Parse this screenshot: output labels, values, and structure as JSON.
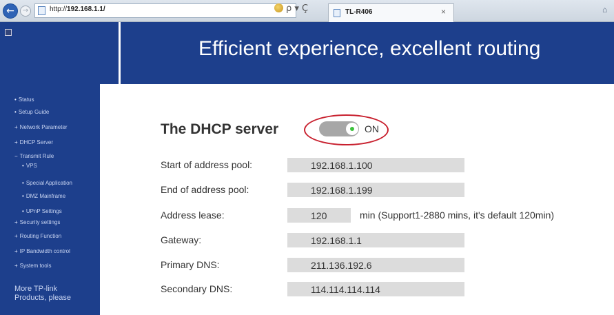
{
  "browser": {
    "url_prefix": "http://",
    "url_host": "192.168.1.1/",
    "tab_title": "TL-R406",
    "tab_close": "×",
    "back_glyph": "←",
    "forward_glyph": "→",
    "search_glyph": "ρ ▾ Ç"
  },
  "header": {
    "slogan": "Efficient experience, excellent routing"
  },
  "sidebar": {
    "items": [
      {
        "label": "Status",
        "bullet": "•"
      },
      {
        "label": "Setup Guide",
        "bullet": "•"
      },
      {
        "label": "Network Parameter",
        "bullet": "+"
      },
      {
        "label": "DHCP Server",
        "bullet": "+"
      },
      {
        "label": "Transmit Rule",
        "bullet": "−"
      },
      {
        "label": "VPS",
        "bullet": "•"
      },
      {
        "label": "Special Application",
        "bullet": "•"
      },
      {
        "label": "DMZ Mainframe",
        "bullet": "•"
      },
      {
        "label": "UPnP Settings",
        "bullet": "•"
      },
      {
        "label": "Security settings",
        "bullet": "+"
      },
      {
        "label": "Routing Function",
        "bullet": "+"
      },
      {
        "label": "IP Bandwidth control",
        "bullet": "+"
      },
      {
        "label": "System tools",
        "bullet": "+"
      }
    ],
    "more_text": "More TP-link Products, please"
  },
  "dhcp": {
    "title": "The DHCP server",
    "toggle_state": "ON",
    "fields": {
      "start": {
        "label": "Start of address pool:",
        "value": "192.168.1.100"
      },
      "end": {
        "label": "End  of address pool:",
        "value": "192.168.1.199"
      },
      "lease": {
        "label": "Address lease:",
        "value": "120",
        "note": "min (Support1-2880 mins, it's default 120min)"
      },
      "gateway": {
        "label": "Gateway:",
        "value": "192.168.1.1"
      },
      "primary_dns": {
        "label": "Primary DNS:",
        "value": "211.136.192.6"
      },
      "secondary_dns": {
        "label": "Secondary DNS:",
        "value": "114.114.114.114"
      }
    }
  },
  "colors": {
    "header_blue": "#1d3f8c",
    "field_gray": "#dcdcdc",
    "annotation_red": "#c8202e",
    "toggle_on_dot": "#3cc23c"
  }
}
